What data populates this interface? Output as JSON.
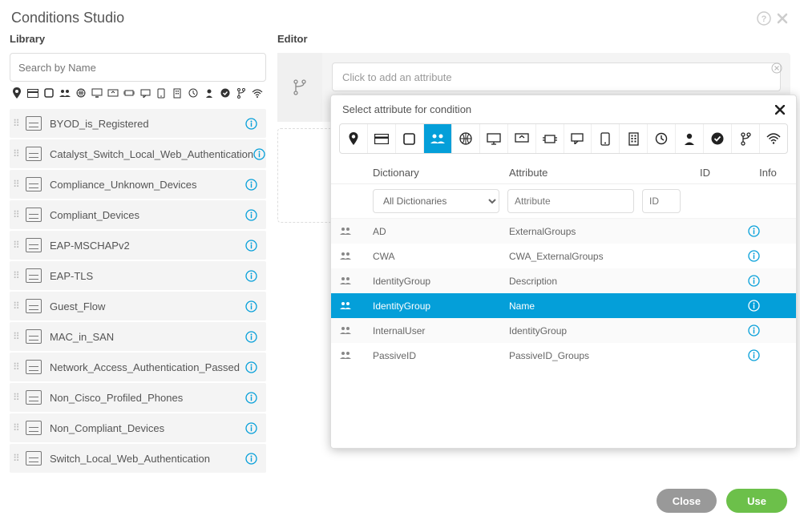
{
  "title": "Conditions Studio",
  "library": {
    "label": "Library",
    "search_placeholder": "Search by Name",
    "items": [
      {
        "label": "BYOD_is_Registered"
      },
      {
        "label": "Catalyst_Switch_Local_Web_Authentication"
      },
      {
        "label": "Compliance_Unknown_Devices"
      },
      {
        "label": "Compliant_Devices"
      },
      {
        "label": "EAP-MSCHAPv2"
      },
      {
        "label": "EAP-TLS"
      },
      {
        "label": "Guest_Flow"
      },
      {
        "label": "MAC_in_SAN"
      },
      {
        "label": "Network_Access_Authentication_Passed"
      },
      {
        "label": "Non_Cisco_Profiled_Phones"
      },
      {
        "label": "Non_Compliant_Devices"
      },
      {
        "label": "Switch_Local_Web_Authentication"
      }
    ]
  },
  "editor": {
    "label": "Editor",
    "attr_click_placeholder": "Click to add an attribute"
  },
  "popup": {
    "title": "Select attribute for condition",
    "columns": {
      "dict": "Dictionary",
      "attr": "Attribute",
      "id": "ID",
      "info": "Info"
    },
    "filter_dict": "All Dictionaries",
    "filter_attr_ph": "Attribute",
    "filter_id_ph": "ID",
    "rows": [
      {
        "dict": "AD",
        "attr": "ExternalGroups",
        "selected": false
      },
      {
        "dict": "CWA",
        "attr": "CWA_ExternalGroups",
        "selected": false
      },
      {
        "dict": "IdentityGroup",
        "attr": "Description",
        "selected": false
      },
      {
        "dict": "IdentityGroup",
        "attr": "Name",
        "selected": true
      },
      {
        "dict": "InternalUser",
        "attr": "IdentityGroup",
        "selected": false
      },
      {
        "dict": "PassiveID",
        "attr": "PassiveID_Groups",
        "selected": false
      }
    ]
  },
  "footer": {
    "close": "Close",
    "use": "Use"
  }
}
